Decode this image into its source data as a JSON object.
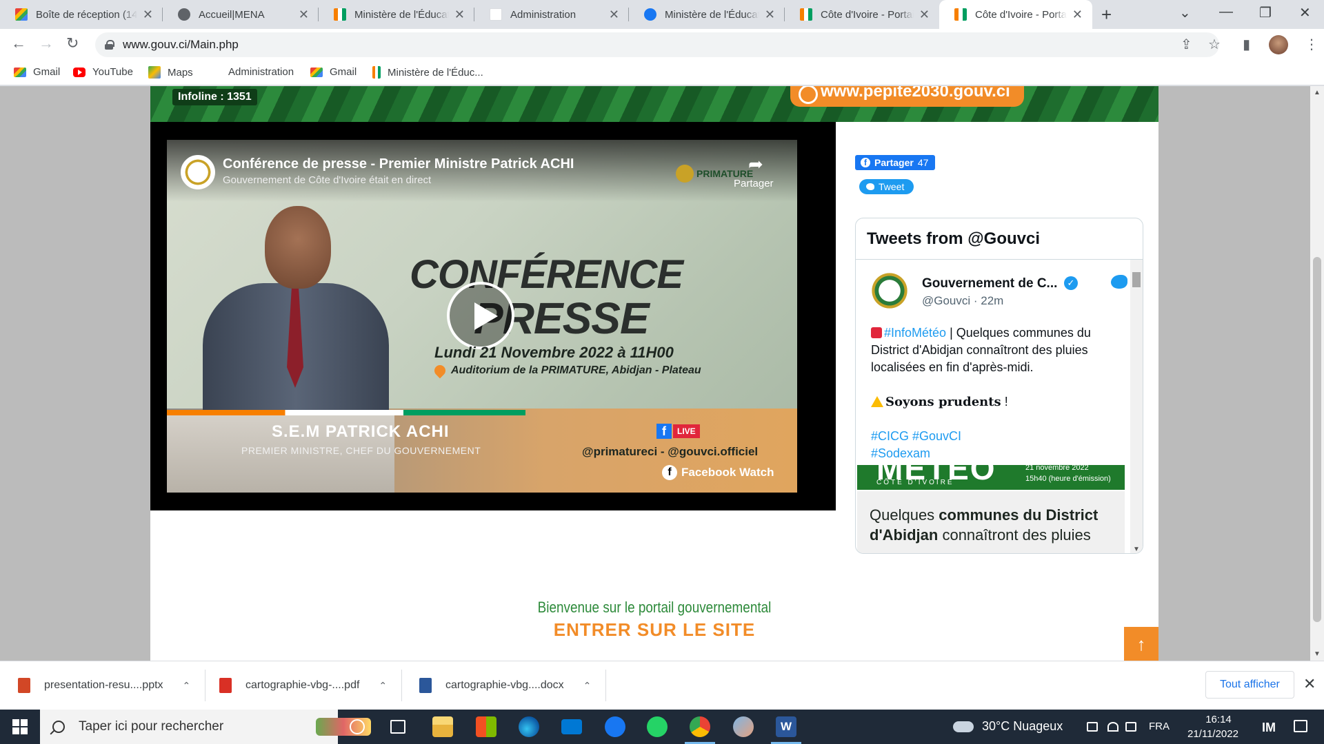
{
  "browser": {
    "tabs": [
      {
        "label": "Boîte de réception (14",
        "favicon": "gmail-icon"
      },
      {
        "label": "Accueil|MENA",
        "favicon": "globe-icon"
      },
      {
        "label": "Ministère de l'Éducati",
        "favicon": "ci-flag-icon"
      },
      {
        "label": "Administration",
        "favicon": "blank-icon"
      },
      {
        "label": "Ministère de l'Éducati",
        "favicon": "facebook-icon"
      },
      {
        "label": "Côte d'Ivoire - Portail",
        "favicon": "ci-flag-icon"
      },
      {
        "label": "Côte d'Ivoire - Portail",
        "favicon": "ci-flag-icon",
        "active": true
      }
    ],
    "url": "www.gouv.ci/Main.php",
    "bookmarks": [
      {
        "label": "Gmail",
        "icon": "gmail-icon"
      },
      {
        "label": "YouTube",
        "icon": "youtube-icon"
      },
      {
        "label": "Maps",
        "icon": "maps-icon"
      },
      {
        "label": "Administration",
        "icon": "none"
      },
      {
        "label": "Gmail",
        "icon": "gmail-icon"
      },
      {
        "label": "Ministère de l'Éduc...",
        "icon": "ci-flag-icon"
      }
    ]
  },
  "page": {
    "banner": {
      "infoline": "Infoline : 1351",
      "pepite": "www.pepite2030.gouv.ci"
    },
    "video": {
      "title": "Conférence de presse - Premier Ministre Patrick ACHI",
      "subtitle": "Gouvernement de Côte d'Ivoire était en direct",
      "share_label": "Partager",
      "primature_label": "PRIMATURE",
      "conf_line1": "CONFÉRENCE",
      "conf_line2": "PRESSE",
      "date": "Lundi 21 Novembre 2022 à 11H00",
      "place": "Auditorium de la PRIMATURE, Abidjan - Plateau",
      "speaker_name": "S.E.M PATRICK ACHI",
      "speaker_role": "PREMIER MINISTRE, CHEF DU GOUVERNEMENT",
      "live_label": "LIVE",
      "handles": "@primatureci - @gouvci.officiel",
      "watch_label": "Facebook Watch"
    },
    "social": {
      "fb_share_label": "Partager",
      "fb_share_count": "47",
      "tweet_label": "Tweet"
    },
    "tweets": {
      "header": "Tweets from @Gouvci",
      "name": "Gouvernement de C...",
      "handle_time": "@Gouvci · 22m",
      "hashtag1": "#InfoMétéo",
      "text1a": " | Quelques communes du",
      "text1b": "District d'Abidjan connaîtront des pluies",
      "text1c": "localisées en fin d'après-midi.",
      "text2": "Soyons prudents",
      "text2_end": " !",
      "hashtags_line1": "#CICG #GouvCI",
      "hashtags_line2": "#Sodexam",
      "media_big": "MÉTÉO",
      "media_small": "CÔTE D'IVOIRE",
      "media_date": "21 novembre 2022",
      "media_time": "15h40 (heure d'émission)",
      "card_line1_a": "Quelques ",
      "card_line1_b": "communes du District",
      "card_line2_a": "d'Abidjan",
      "card_line2_b": " connaîtront des pluies"
    },
    "welcome": "Bienvenue sur le portail gouvernemental",
    "enter": "ENTRER SUR LE SITE",
    "scroll_top": "↑"
  },
  "downloads": {
    "items": [
      {
        "label": "presentation-resu....pptx",
        "icon": "pptx-icon"
      },
      {
        "label": "cartographie-vbg-....pdf",
        "icon": "pdf-icon"
      },
      {
        "label": "cartographie-vbg....docx",
        "icon": "docx-icon"
      }
    ],
    "show_all": "Tout afficher"
  },
  "taskbar": {
    "search_placeholder": "Taper ici pour rechercher",
    "weather": "30°C  Nuageux",
    "lang": "FRA",
    "time": "16:14",
    "date": "21/11/2022"
  }
}
